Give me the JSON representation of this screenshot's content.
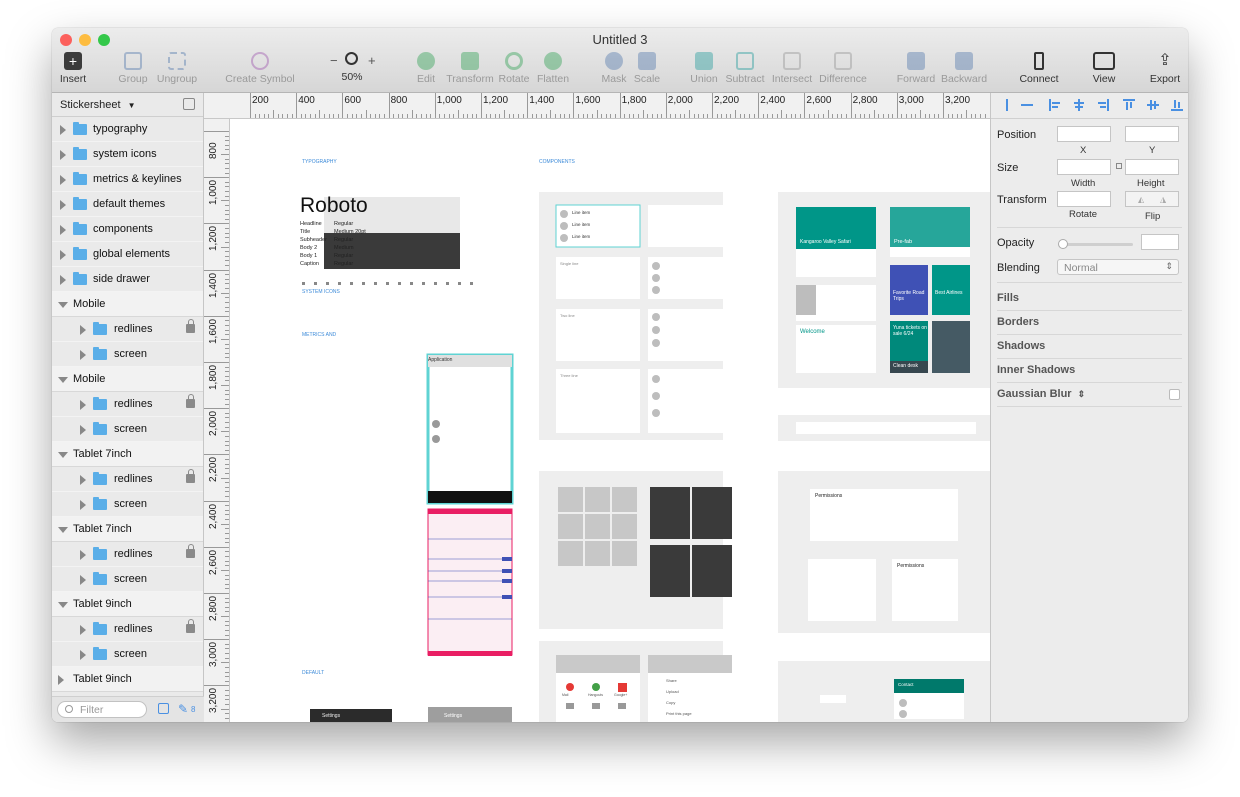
{
  "window": {
    "title": "Untitled 3"
  },
  "toolbar": {
    "insert": "Insert",
    "group": "Group",
    "ungroup": "Ungroup",
    "create_symbol": "Create Symbol",
    "zoom_minus": "−",
    "zoom_plus": "+",
    "zoom_level": "50%",
    "edit": "Edit",
    "transform": "Transform",
    "rotate": "Rotate",
    "flatten": "Flatten",
    "mask": "Mask",
    "scale": "Scale",
    "union": "Union",
    "subtract": "Subtract",
    "intersect": "Intersect",
    "difference": "Difference",
    "forward": "Forward",
    "backward": "Backward",
    "connect": "Connect",
    "view": "View",
    "export": "Export"
  },
  "sidebar": {
    "page_name": "Stickersheet",
    "filter_placeholder": "Filter",
    "layer_count": "8",
    "top_folders": [
      "typography",
      "system icons",
      "metrics & keylines",
      "default themes",
      "components",
      "global elements",
      "side drawer"
    ],
    "groups": [
      {
        "name": "Mobile",
        "children": [
          "redlines",
          "screen"
        ]
      },
      {
        "name": "Mobile",
        "children": [
          "redlines",
          "screen"
        ]
      },
      {
        "name": "Tablet 7inch",
        "children": [
          "redlines",
          "screen"
        ]
      },
      {
        "name": "Tablet 7inch",
        "children": [
          "redlines",
          "screen"
        ]
      },
      {
        "name": "Tablet 9inch",
        "children": [
          "redlines",
          "screen"
        ]
      },
      {
        "name": "Tablet 9inch",
        "children": []
      }
    ]
  },
  "ruler": {
    "top": [
      "200",
      "400",
      "600",
      "800",
      "1,000",
      "1,200",
      "1,400",
      "1,600",
      "1,800",
      "2,000",
      "2,200",
      "2,400",
      "2,600",
      "2,800",
      "3,000",
      "3,200"
    ],
    "left": [
      "800",
      "1,000",
      "1,200",
      "1,400",
      "1,600",
      "1,800",
      "2,000",
      "2,200",
      "2,400",
      "2,600",
      "2,800",
      "3,000",
      "3,200"
    ]
  },
  "canvas": {
    "section_typography": "TYPOGRAPHY",
    "section_components": "COMPONENTS",
    "section_system_icons": "SYSTEM ICONS",
    "section_metrics": "METRICS AND",
    "section_default": "DEFAULT",
    "roboto": "Roboto",
    "type_rows": [
      {
        "name": "Headline",
        "weight": "Regular"
      },
      {
        "name": "Title",
        "weight": "Medium 20pt"
      },
      {
        "name": "Subheader",
        "weight": "Regular"
      },
      {
        "name": "Body 2",
        "weight": "Medium"
      },
      {
        "name": "Body 1",
        "weight": "Regular"
      },
      {
        "name": "Caption",
        "weight": "Regular"
      }
    ],
    "list_items": [
      "Line item",
      "Line item",
      "Line item"
    ],
    "single_line": "Single line",
    "two_line": "Two line",
    "three_line": "Three line",
    "card_title_1": "Kangaroo Valley Safari",
    "card_pre_fab": "Pre-fab",
    "card_favorite": "Favorite Road Trips",
    "card_best": "Best Airlines",
    "card_welcome": "Welcome",
    "card_yuna": "Yuna tickets on sale 6/24",
    "card_clean": "Clean desk",
    "dialog_title": "Permissions",
    "dialog_title_2": "Permissions",
    "app_bar": "Application",
    "settings_dark": "Settings",
    "settings_light": "Settings",
    "contact": "Contact",
    "menu_items": [
      "Mail",
      "Hangouts",
      "Google+"
    ],
    "share_items": [
      "Share",
      "Upload",
      "Copy",
      "Print this page"
    ]
  },
  "inspector": {
    "position": "Position",
    "x": "X",
    "y": "Y",
    "size": "Size",
    "width": "Width",
    "height": "Height",
    "transform": "Transform",
    "rotate": "Rotate",
    "flip": "Flip",
    "opacity": "Opacity",
    "blending": "Blending",
    "blending_value": "Normal",
    "fills": "Fills",
    "borders": "Borders",
    "shadows": "Shadows",
    "inner_shadows": "Inner Shadows",
    "gaussian_blur": "Gaussian Blur"
  },
  "colors": {
    "accent": "#4a90e2",
    "teal": "#009688",
    "indigo": "#3f51b5",
    "pink": "#e91e63",
    "folder": "#5aaee8"
  }
}
